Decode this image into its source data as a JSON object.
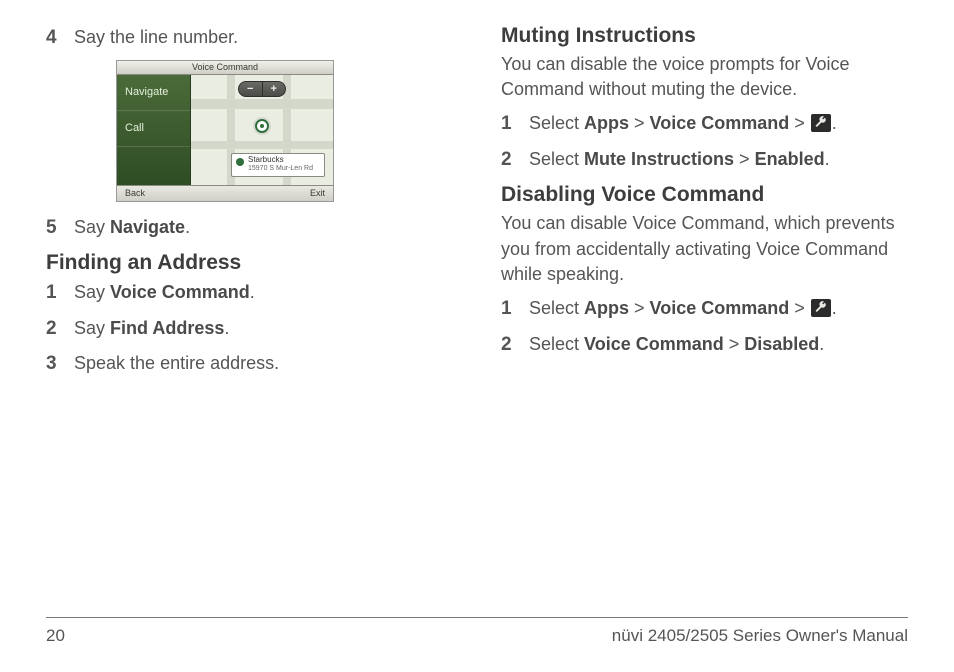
{
  "left": {
    "step4": {
      "num": "4",
      "text": "Say the line number."
    },
    "step5": {
      "num": "5",
      "pre": "Say ",
      "bold": "Navigate",
      "post": "."
    },
    "finding_heading": "Finding an Address",
    "fa1": {
      "num": "1",
      "pre": "Say ",
      "bold": "Voice Command",
      "post": "."
    },
    "fa2": {
      "num": "2",
      "pre": "Say ",
      "bold": "Find Address",
      "post": "."
    },
    "fa3": {
      "num": "3",
      "text": "Speak the entire address."
    }
  },
  "device": {
    "title": "Voice Command",
    "side1": "Navigate",
    "side2": "Call",
    "callout_name": "Starbucks",
    "callout_addr": "15970 S Mur-Len Rd",
    "back": "Back",
    "exit": "Exit",
    "zoom_minus": "−",
    "zoom_plus": "+"
  },
  "right": {
    "muting_heading": "Muting Instructions",
    "muting_intro": "You can disable the voice prompts for Voice Command without muting the device.",
    "m1": {
      "num": "1",
      "pre": "Select ",
      "b1": "Apps",
      "sep1": " > ",
      "b2": "Voice Command",
      "sep2": " > ",
      "post": "."
    },
    "m2": {
      "num": "2",
      "pre": "Select ",
      "b1": "Mute Instructions",
      "sep1": " > ",
      "b2": "Enabled",
      "post": "."
    },
    "disabling_heading": "Disabling Voice Command",
    "disabling_intro": "You can disable Voice Command, which prevents you from accidentally activating Voice Command while speaking.",
    "d1": {
      "num": "1",
      "pre": "Select ",
      "b1": "Apps",
      "sep1": " > ",
      "b2": "Voice Command",
      "sep2": " > ",
      "post": "."
    },
    "d2": {
      "num": "2",
      "pre": "Select ",
      "b1": "Voice Command",
      "sep1": " > ",
      "b2": "Disabled",
      "post": "."
    }
  },
  "footer": {
    "page": "20",
    "title": "nüvi 2405/2505 Series Owner's Manual"
  }
}
